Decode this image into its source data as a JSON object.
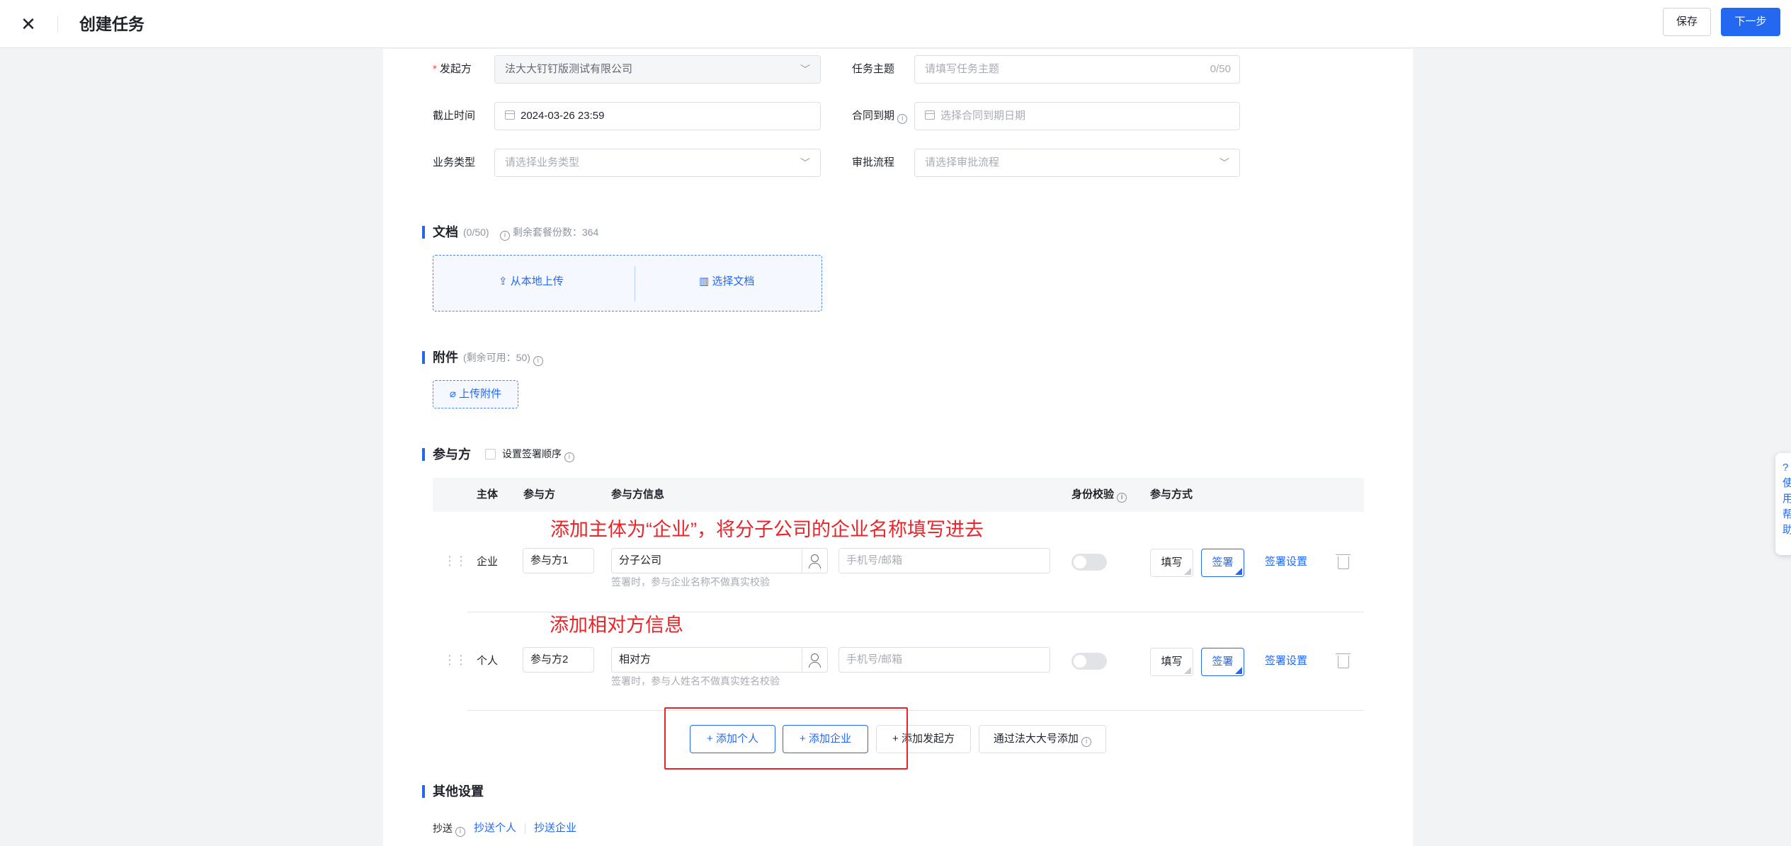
{
  "header": {
    "title": "创建任务",
    "save_label": "保存",
    "next_label": "下一步"
  },
  "form": {
    "initiator_label": "发起方",
    "initiator_value": "法大大钉钉版测试有限公司",
    "subject_label": "任务主题",
    "subject_placeholder": "请填写任务主题",
    "subject_count": "0/50",
    "deadline_label": "截止时间",
    "deadline_value": "2024-03-26 23:59",
    "contract_expiry_label": "合同到期",
    "contract_expiry_placeholder": "选择合同到期日期",
    "biz_type_label": "业务类型",
    "biz_type_placeholder": "请选择业务类型",
    "approval_label": "审批流程",
    "approval_placeholder": "请选择审批流程"
  },
  "documents": {
    "title": "文档",
    "count": "(0/50)",
    "remaining": "剩余套餐份数：364",
    "upload_local": "从本地上传",
    "select_doc": "选择文档"
  },
  "attachments": {
    "title": "附件",
    "remaining": "(剩余可用：50)",
    "upload_label": "上传附件"
  },
  "participants": {
    "title": "参与方",
    "order_label": "设置签署顺序",
    "headers": {
      "subject": "主体",
      "party": "参与方",
      "info": "参与方信息",
      "identity": "身份校验",
      "mode": "参与方式"
    },
    "rows": [
      {
        "subject": "企业",
        "party": "参与方1",
        "name": "分子公司",
        "contact_placeholder": "手机号/邮箱",
        "hint": "签署时，参与企业名称不做真实校验",
        "fill": "填写",
        "sign": "签署",
        "settings": "签署设置"
      },
      {
        "subject": "个人",
        "party": "参与方2",
        "name": "相对方",
        "contact_placeholder": "手机号/邮箱",
        "hint": "签署时，参与人姓名不做真实姓名校验",
        "fill": "填写",
        "sign": "签署",
        "settings": "签署设置"
      }
    ],
    "annotations": [
      "添加主体为“企业”，将分子公司的企业名称填写进去",
      "添加相对方信息"
    ],
    "buttons": {
      "add_person": "添加个人",
      "add_company": "添加企业",
      "add_initiator": "添加发起方",
      "add_via_fadada": "通过法大大号添加"
    }
  },
  "other": {
    "title": "其他设置",
    "cc_label": "抄送",
    "cc_person": "抄送个人",
    "cc_company": "抄送企业"
  },
  "side_float": [
    "?",
    "使",
    "用",
    "帮",
    "助"
  ],
  "colors": {
    "accent": "#2468f2",
    "annotation": "#e8262a"
  }
}
